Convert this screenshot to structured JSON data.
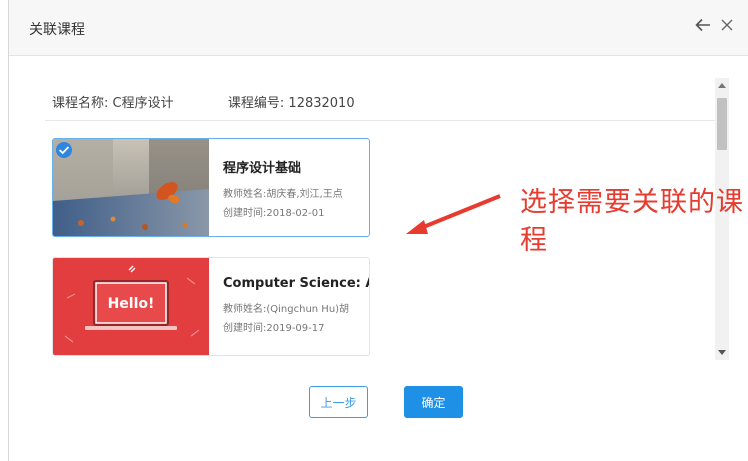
{
  "dialog": {
    "title": "关联课程"
  },
  "course_info": {
    "name_label": "课程名称:",
    "name_value": "C程序设计",
    "code_label": "课程编号:",
    "code_value": "12832010"
  },
  "courses": [
    {
      "name": "程序设计基础",
      "teacher_label": "教师姓名:",
      "teacher": "胡庆春,刘江,王点",
      "created_label": "创建时间:",
      "created": "2018-02-01",
      "selected": true
    },
    {
      "name": "Computer Science: Al",
      "teacher_label": "教师姓名:",
      "teacher": "(Qingchun Hu)胡",
      "created_label": "创建时间:",
      "created": "2019-09-17",
      "thumb_text": "Hello!",
      "selected": false
    }
  ],
  "buttons": {
    "prev": "上一步",
    "confirm": "确定"
  },
  "annotation": {
    "text": "选择需要关联的课程"
  },
  "icons": {
    "back": "arrow-left-icon",
    "close": "close-icon",
    "check": "check-icon"
  },
  "colors": {
    "accent": "#1e90e6",
    "annotation": "#e63b2e"
  }
}
